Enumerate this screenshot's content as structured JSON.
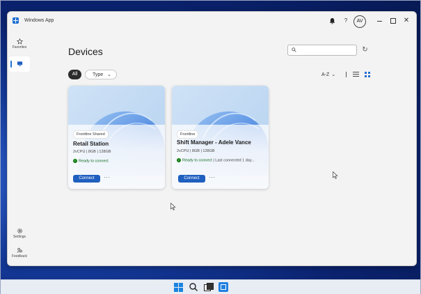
{
  "app": {
    "title": "Windows App",
    "avatar_initials": "AV",
    "help_glyph": "?",
    "close_glyph": "✕"
  },
  "sidebar": {
    "items": [
      {
        "label": "Favorites",
        "icon": "star-icon"
      },
      {
        "label": "",
        "icon": "monitor-icon",
        "selected": true
      },
      {
        "label": "Settings",
        "icon": "gear-icon"
      },
      {
        "label": "Feedback",
        "icon": "people-feedback-icon"
      }
    ]
  },
  "main": {
    "title": "Devices",
    "search": {
      "placeholder": ""
    },
    "filters": {
      "all": "All",
      "type": "Type"
    },
    "sort": "A-Z",
    "view_mode": "grid"
  },
  "cards": [
    {
      "badge": "Frontline Shared",
      "name": "Retail Station",
      "specs": "2vCPU | 8GB | 128GB",
      "status": "Ready to connect",
      "status_extra": "",
      "connect": "Connect",
      "more": "···"
    },
    {
      "badge": "Frontline",
      "name": "Shift Manager - Adele Vance",
      "specs": "2vCPU | 8GB | 128GB",
      "status": "Ready to connect",
      "status_extra": "| Last connected 1 day...",
      "connect": "Connect",
      "more": "···"
    }
  ],
  "colors": {
    "accent": "#1f5fbf",
    "status_ok": "#107c10",
    "desktop": "#143a9a"
  }
}
